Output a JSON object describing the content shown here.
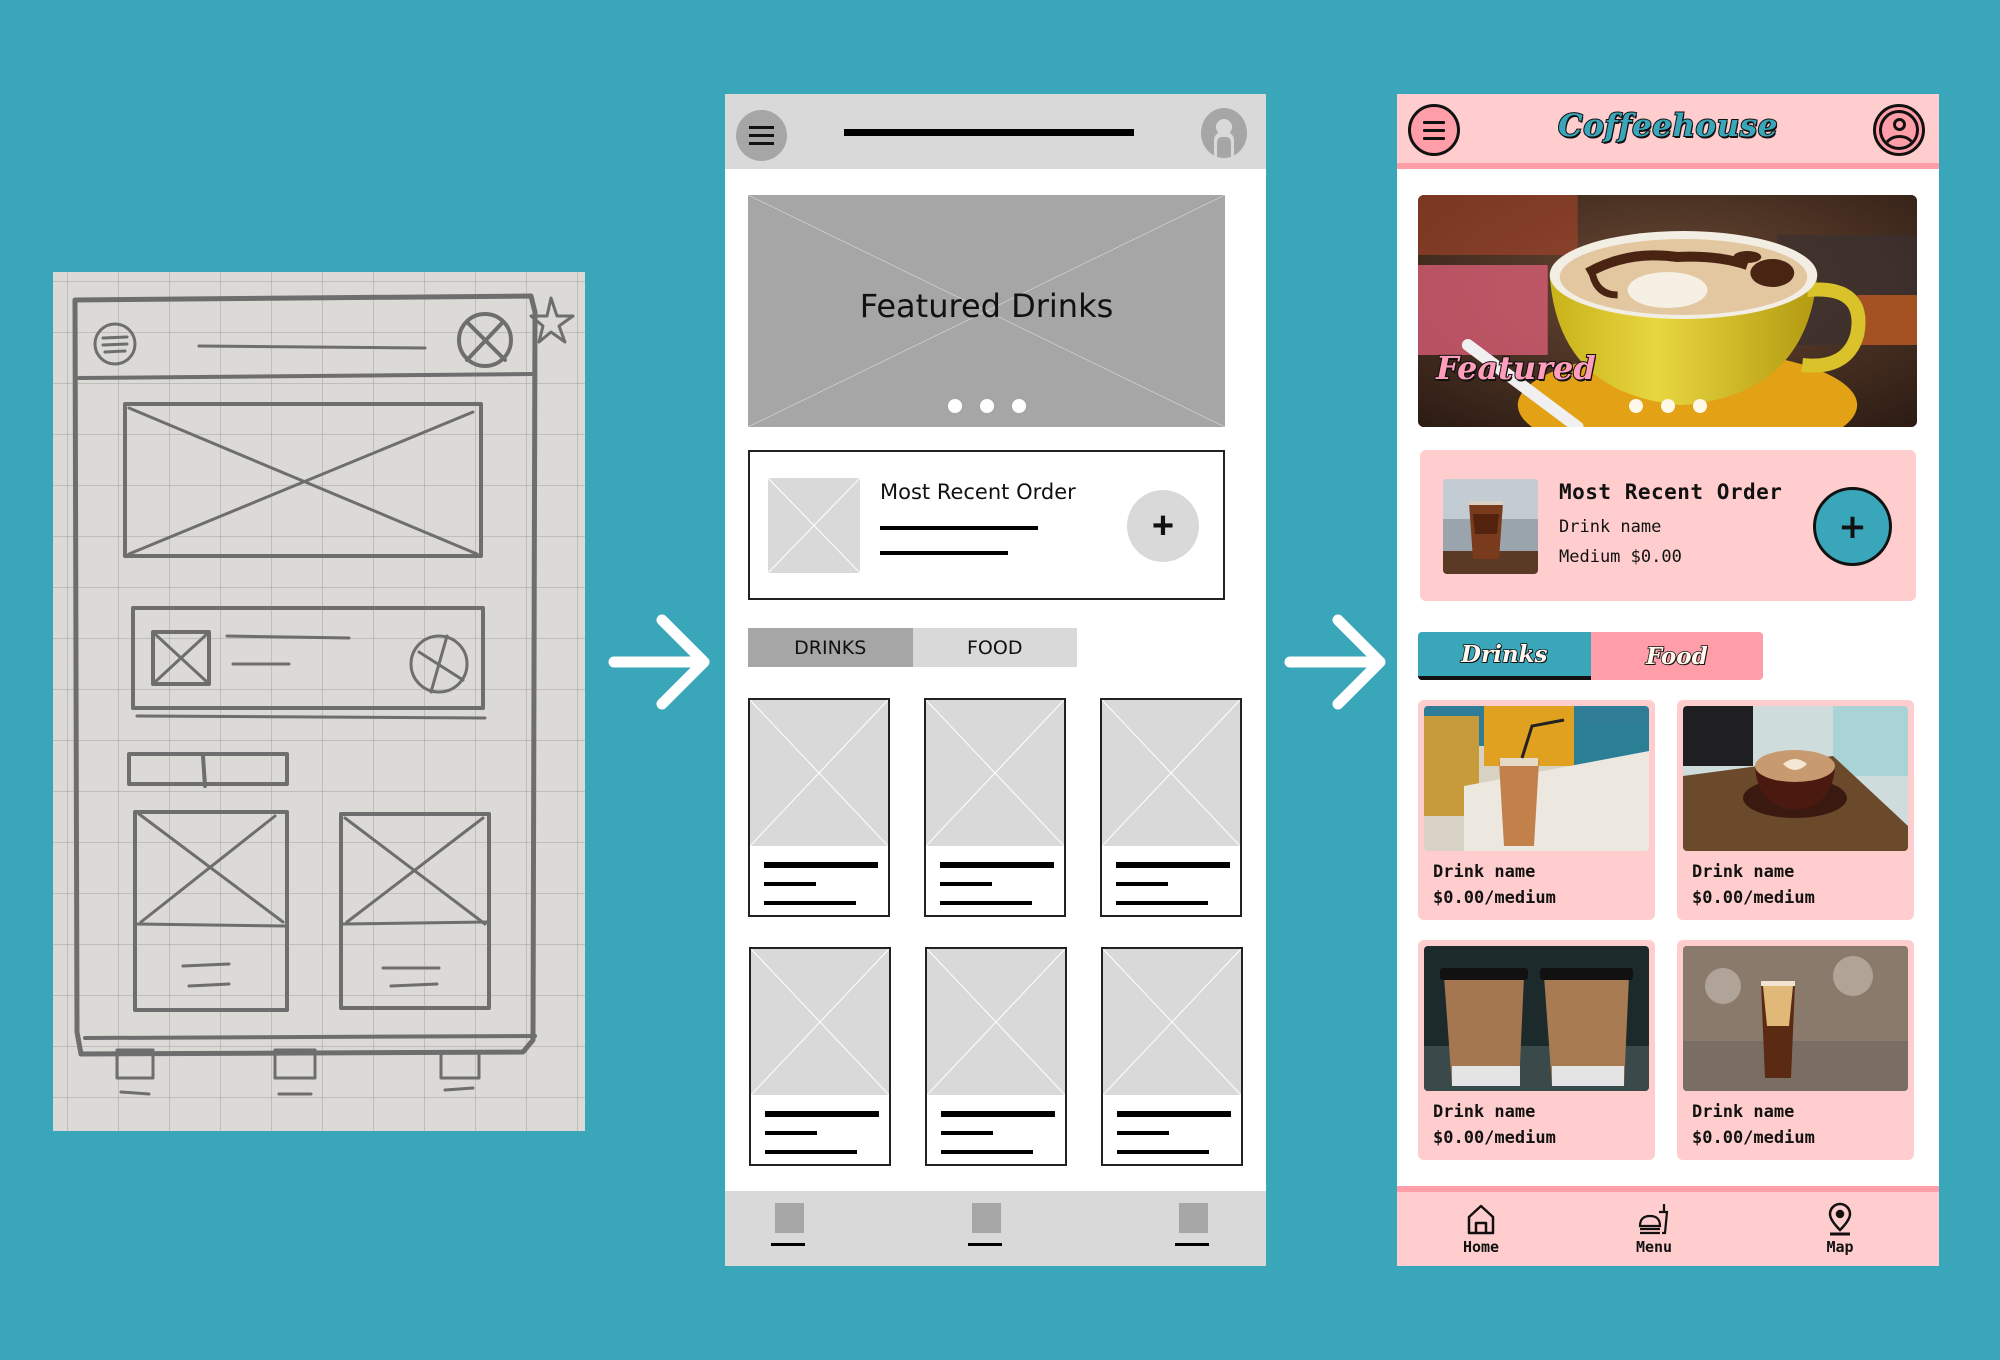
{
  "colors": {
    "background": "#3aa6ba",
    "wireframe_light": "#d9d9d9",
    "wireframe_mid": "#a6a6a6",
    "brand_pink_light": "#ffcdcd",
    "brand_pink": "#ff9ea8",
    "brand_teal": "#3aa6ba"
  },
  "sketch": {
    "label": "Paper sketch",
    "icons": [
      "menu-icon",
      "profile-icon",
      "star-icon",
      "image-placeholder",
      "add-icon"
    ]
  },
  "flow_arrows": [
    "arrow-right-icon",
    "arrow-right-icon"
  ],
  "wireframe": {
    "header": {
      "menu_icon": "menu-icon",
      "avatar_icon": "user-icon"
    },
    "hero": {
      "title": "Featured Drinks",
      "carousel_dots": 3
    },
    "recent_order": {
      "title": "Most Recent Order",
      "add_label": "+"
    },
    "tabs": [
      {
        "label": "DRINKS",
        "active": true
      },
      {
        "label": "FOOD",
        "active": false
      }
    ],
    "cards": 6,
    "nav_items": 3
  },
  "app": {
    "header": {
      "logo": "Coffeehouse",
      "menu_icon": "menu-icon",
      "profile_icon": "user-icon"
    },
    "hero": {
      "label": "Featured",
      "carousel_dots": 3,
      "active_dot": 1
    },
    "recent_order": {
      "title": "Most Recent Order",
      "drink_name": "Drink name",
      "size_price": "Medium $0.00",
      "add_label": "+"
    },
    "tabs": [
      {
        "label": "Drinks",
        "active": true
      },
      {
        "label": "Food",
        "active": false
      }
    ],
    "products": [
      {
        "name": "Drink name",
        "price": "$0.00/medium",
        "image": "iced latte"
      },
      {
        "name": "Drink name",
        "price": "$0.00/medium",
        "image": "latte art cup"
      },
      {
        "name": "Drink name",
        "price": "$0.00/medium",
        "image": "paper to-go cups"
      },
      {
        "name": "Drink name",
        "price": "$0.00/medium",
        "image": "iced coffee glass"
      }
    ],
    "nav": [
      {
        "label": "Home",
        "icon": "home-icon"
      },
      {
        "label": "Menu",
        "icon": "menu-food-icon"
      },
      {
        "label": "Map",
        "icon": "map-pin-icon"
      }
    ]
  }
}
